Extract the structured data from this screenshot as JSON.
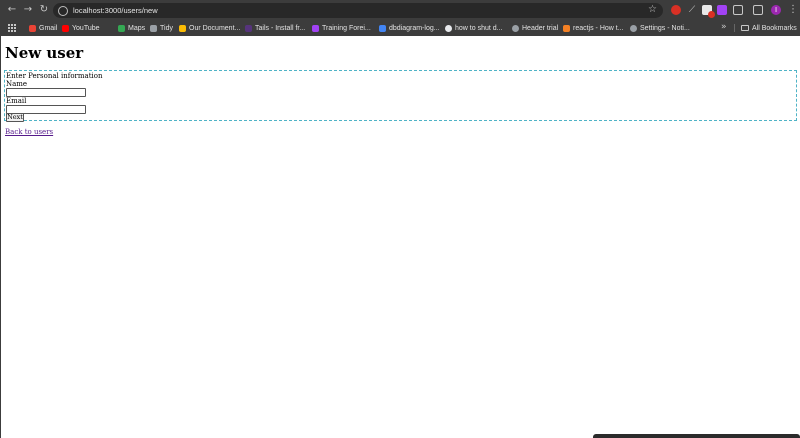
{
  "browser": {
    "url": "localhost:3000/users/new",
    "profile_initial": "I",
    "bookmarks": [
      {
        "label": "Gmail",
        "color": "#ea4335"
      },
      {
        "label": "YouTube",
        "color": "#ff0000"
      },
      {
        "label": "Maps",
        "color": "#34a853"
      },
      {
        "label": "Tidy",
        "color": "#9aa0a6"
      },
      {
        "label": "Our Document...",
        "color": "#fbbc04"
      },
      {
        "label": "Tails - Install fr...",
        "color": "#56347c"
      },
      {
        "label": "Training Forei...",
        "color": "#a142f4"
      },
      {
        "label": "dbdiagram-log...",
        "color": "#4285f4"
      },
      {
        "label": "how to shut d...",
        "color": "#e8eaed"
      },
      {
        "label": "Header trial",
        "color": "#9aa0a6"
      },
      {
        "label": "reactjs - How t...",
        "color": "#f48024"
      },
      {
        "label": "Settings - Noti...",
        "color": "#9aa0a6"
      }
    ],
    "all_bookmarks_label": "All Bookmarks"
  },
  "page": {
    "title": "New user",
    "legend": "Enter Personal information",
    "name_label": "Name",
    "name_value": "",
    "email_label": "Email",
    "email_value": "",
    "next_button": "Next",
    "back_link": "Back to users"
  },
  "colors": {
    "fieldset_border": "#4fb3c6",
    "visited_link": "#551a8b"
  }
}
